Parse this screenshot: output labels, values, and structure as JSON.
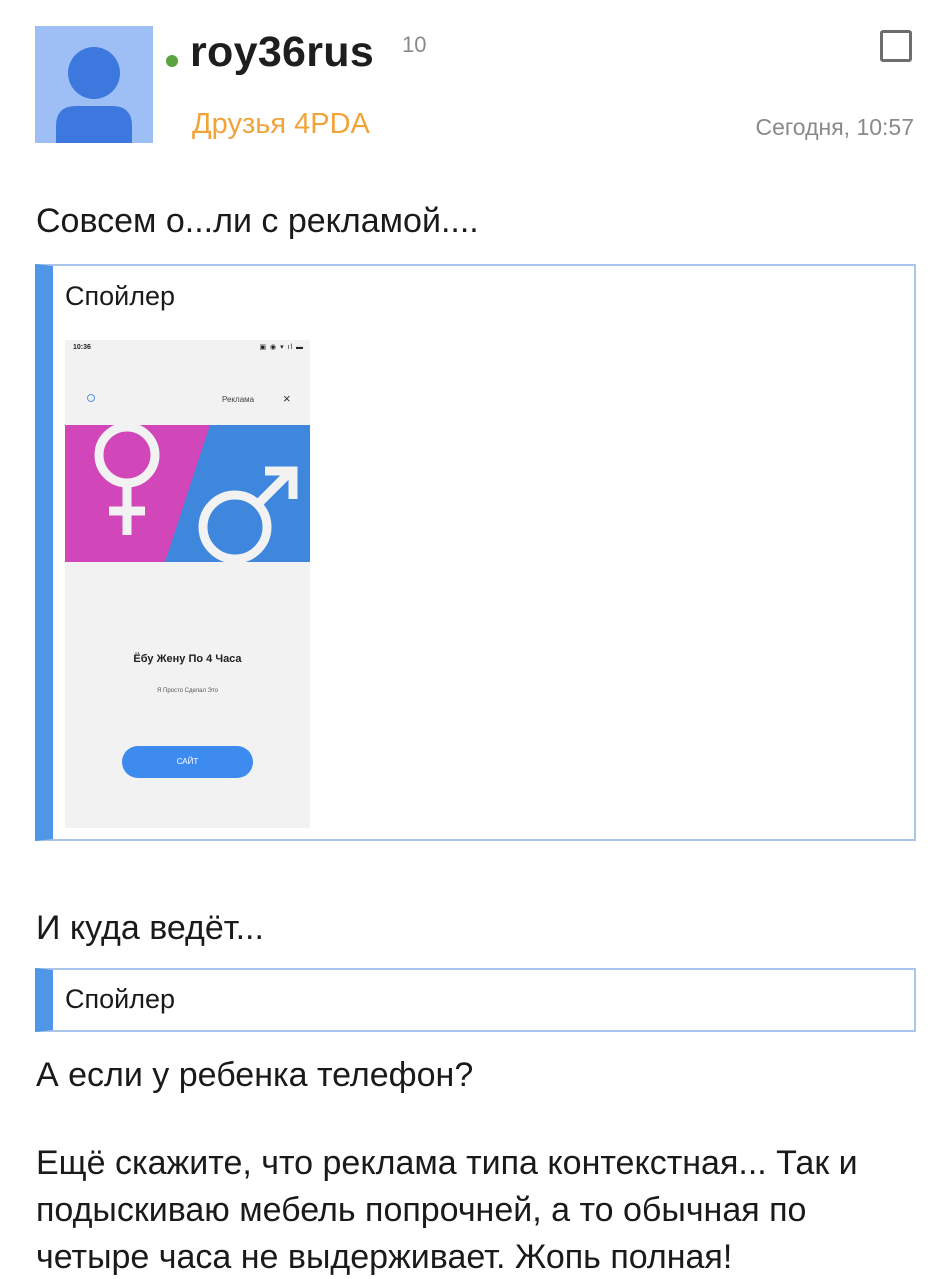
{
  "post": {
    "username": "roy36rus",
    "reputation": "10",
    "group": "Друзья 4PDA",
    "time": "Сегодня, 10:57",
    "paragraphs": [
      "Совсем о...ли с рекламой....",
      "И куда ведёт...",
      "А если у ребенка телефон?",
      "Ещё скажите, что реклама типа контекстная... Так и подыскиваю мебель попрочней, а то обычная по четыре часа не выдерживает. Жопь полная!"
    ]
  },
  "spoilers": [
    {
      "title": "Спойлер"
    },
    {
      "title": "Спойлер"
    }
  ],
  "screenshot": {
    "time": "10:36",
    "status_icons": "▣ ◉ ▾ ıl ▬",
    "ad_label": "Реклама",
    "close_glyph": "×",
    "headline": "Ёбу Жену По 4 Часа",
    "subtitle": "Я Просто Сделал Это",
    "cta": "САЙТ"
  },
  "colors": {
    "username": "#1e1e1e",
    "online": "#5aa33e",
    "group": "#f0a43a",
    "muted": "#8a8a8a",
    "spoiler_accent": "#4f95e8",
    "spoiler_border": "#a9c6ea",
    "avatar_bg": "#9ebff5",
    "avatar_fg": "#3d78de",
    "banner_pink": "#d146b8",
    "banner_blue": "#3f86dd",
    "cta_blue": "#3e8bf0"
  }
}
